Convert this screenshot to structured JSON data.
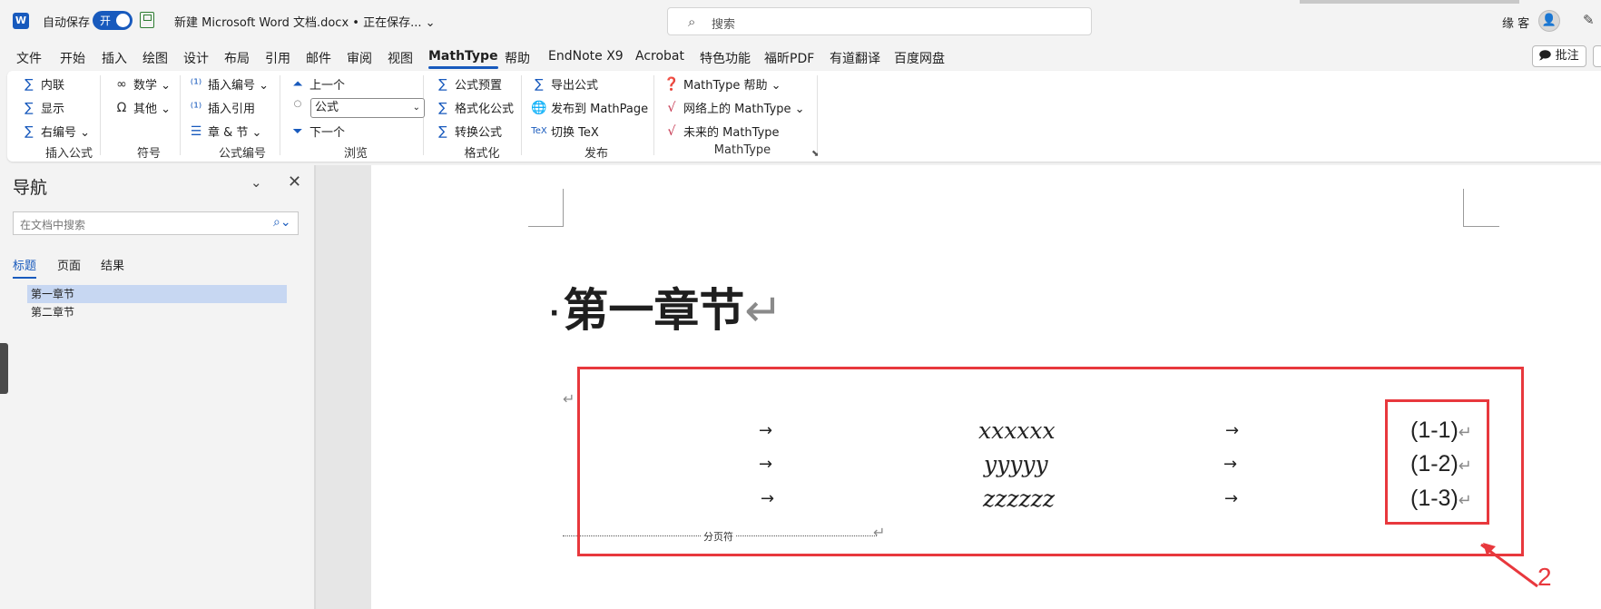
{
  "titlebar": {
    "app_icon": "W",
    "autosave_label": "自动保存",
    "autosave_state": "开",
    "document_title": "新建 Microsoft Word 文档.docx • 正在保存... ⌄",
    "search_placeholder": "搜索",
    "user_name": "缘 客"
  },
  "menu": {
    "tabs": [
      "文件",
      "开始",
      "插入",
      "绘图",
      "设计",
      "布局",
      "引用",
      "邮件",
      "审阅",
      "视图",
      "MathType",
      "帮助",
      "EndNote X9",
      "Acrobat",
      "特色功能",
      "福昕PDF",
      "有道翻译",
      "百度网盘"
    ],
    "active_tab": "MathType",
    "comment_button": "批注"
  },
  "ribbon": {
    "insert_equation": {
      "items": [
        "内联",
        "显示",
        "右编号 ⌄"
      ],
      "label": "插入公式"
    },
    "symbols": {
      "items": [
        "数学 ⌄",
        "其他 ⌄"
      ],
      "label": "符号"
    },
    "equation_numbers": {
      "items": [
        "插入编号 ⌄",
        "插入引用",
        "章 & 节 ⌄"
      ],
      "label": "公式编号"
    },
    "browse": {
      "items": [
        "上一个",
        "下一个"
      ],
      "select_value": "公式",
      "label": "浏览"
    },
    "format": {
      "items": [
        "公式预置",
        "格式化公式",
        "转换公式"
      ],
      "label": "格式化"
    },
    "publish": {
      "items": [
        "导出公式",
        "发布到 MathPage",
        "切换 TeX"
      ],
      "label": "发布"
    },
    "mathtype": {
      "items": [
        "MathType 帮助 ⌄",
        "网络上的 MathType ⌄",
        "未来的 MathType"
      ],
      "label": "MathType"
    }
  },
  "navpane": {
    "title": "导航",
    "search_placeholder": "在文档中搜索",
    "tabs": [
      "标题",
      "页面",
      "结果"
    ],
    "active_tab": "标题",
    "headings": [
      "第一章节",
      "第二章节"
    ],
    "selected_heading": "第一章节"
  },
  "document": {
    "heading": "第一章节",
    "tab_arrow": "→",
    "pilcrow": "↵",
    "equations": [
      {
        "expr": "xxxxxx",
        "number": "(1-1)"
      },
      {
        "expr": "yyyyy",
        "number": "(1-2)"
      },
      {
        "expr": "zzzzzz",
        "number": "(1-3)"
      }
    ],
    "page_break_label": "分页符"
  },
  "annotation": {
    "number": "2",
    "color": "#e8383d"
  },
  "colors": {
    "accent": "#185abd",
    "annotation_red": "#e8383d",
    "nav_selection": "#c7d7f2"
  }
}
